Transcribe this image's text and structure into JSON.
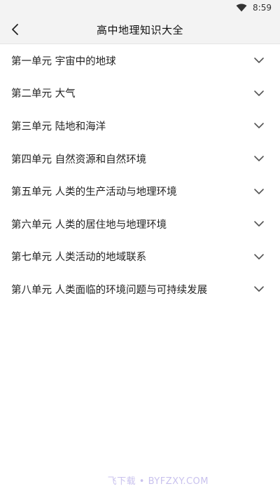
{
  "status_bar": {
    "time": "8:59"
  },
  "header": {
    "title": "高中地理知识大全",
    "back_icon": "chevron-left"
  },
  "units": [
    {
      "label": "第一单元 宇宙中的地球"
    },
    {
      "label": "第二单元 大气"
    },
    {
      "label": "第三单元 陆地和海洋"
    },
    {
      "label": "第四单元 自然资源和自然环境"
    },
    {
      "label": "第五单元 人类的生产活动与地理环境"
    },
    {
      "label": "第六单元 人类的居住地与地理环境"
    },
    {
      "label": "第七单元 人类活动的地域联系"
    },
    {
      "label": "第八单元 人类面临的环境问题与可持续发展"
    }
  ],
  "watermark": "飞下载 • BYFZXY.COM"
}
